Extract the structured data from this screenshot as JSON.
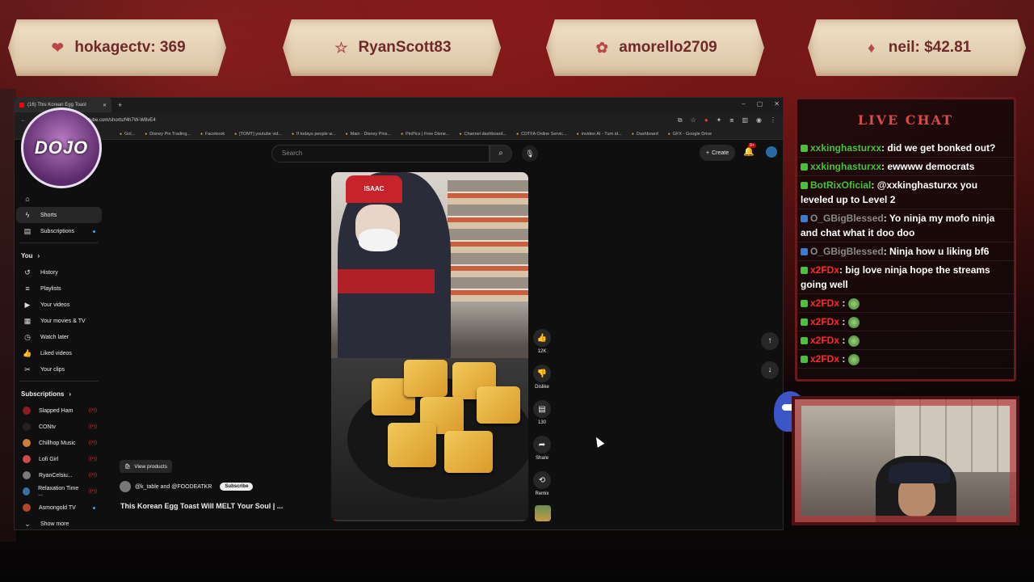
{
  "overlay": {
    "names": [
      {
        "text": "hokagectv: 369",
        "icon": "heart-badge-icon"
      },
      {
        "text": "RyanScott83",
        "icon": "star-icon"
      },
      {
        "text": "amorello2709",
        "icon": "gift-icon"
      },
      {
        "text": "neil: $42.81",
        "icon": "diamond-icon"
      }
    ],
    "logo_text": "DOJO"
  },
  "browser": {
    "tab_title": "(16) This Korean Egg Toast",
    "url": "youtube.com/shorts/f4h7W-W8vE4",
    "bookmarks": [
      "Gol...",
      "Disney Pin Trading...",
      "Facebook",
      "[TOMT] youtube vid...",
      "If todays people w...",
      "Main - Disney Pins...",
      "PinPics | Free Disne...",
      "Channel dashboard...",
      "CDTFA Online Servic...",
      "invideo AI - Turn id...",
      "Dashboard",
      "GFX - Google Drive"
    ]
  },
  "youtube": {
    "search_placeholder": "Search",
    "create_label": "Create",
    "notif_count": "9+",
    "nav": {
      "shorts": "Shorts",
      "subscriptions": "Subscriptions",
      "you": "You",
      "history": "History",
      "playlists": "Playlists",
      "your_videos": "Your videos",
      "movies": "Your movies & TV",
      "watch_later": "Watch later",
      "liked": "Liked videos",
      "clips": "Your clips",
      "subs_header": "Subscriptions",
      "show_more": "Show more"
    },
    "subscriptions": [
      {
        "name": "Slapped Ham",
        "color": "#8a1d1d",
        "status": "live"
      },
      {
        "name": "CONtv",
        "color": "#222222",
        "status": "live"
      },
      {
        "name": "Chillhop Music",
        "color": "#c9803a",
        "status": "live"
      },
      {
        "name": "Lofi Girl",
        "color": "#d04a4a",
        "status": "live"
      },
      {
        "name": "RyanCelsiu...",
        "color": "#7a7a7a",
        "status": "live"
      },
      {
        "name": "Relaxation Time ...",
        "color": "#3b6fa0",
        "status": "live"
      },
      {
        "name": "Asmongold TV",
        "color": "#b5452b",
        "status": "new"
      }
    ],
    "actions": {
      "likes": "12K",
      "dislike": "Dislike",
      "comments": "130",
      "share": "Share",
      "remix": "Remix"
    },
    "video": {
      "view_products": "View products",
      "channel": "@k_table and @FOODEATKR",
      "subscribe": "Subscribe",
      "title": "This Korean Egg Toast Will MELT Your Soul  | ...",
      "cap_text": "ISAAC",
      "progress": 0.02
    }
  },
  "chat": {
    "title": "LIVE CHAT",
    "messages": [
      {
        "user": "xxkinghasturxx",
        "cls": "u-green",
        "text": ": did we get bonked out?",
        "badge": "#49c23a"
      },
      {
        "user": "xxkinghasturxx",
        "cls": "u-green",
        "text": ": ewwww democrats",
        "badge": "#49c23a"
      },
      {
        "user": "BotRixOficial",
        "cls": "u-green",
        "text": ": @xxkinghasturxx you leveled up to Level 2",
        "badge": "#49c23a"
      },
      {
        "user": "O_GBigBlessed",
        "cls": "u-gray",
        "text": ": Yo ninja my mofo ninja and chat what it doo doo",
        "badge": "#3a7bd5"
      },
      {
        "user": "O_GBigBlessed",
        "cls": "u-gray",
        "text": ": Ninja how u liking bf6",
        "badge": "#3a7bd5"
      },
      {
        "user": "x2FDx",
        "cls": "u-red",
        "text": ": big love ninja hope the streams going well",
        "badge": "#49c23a"
      },
      {
        "user": "x2FDx",
        "cls": "u-red",
        "text": " : ",
        "badge": "#49c23a",
        "emote": true
      },
      {
        "user": "x2FDx",
        "cls": "u-red",
        "text": " : ",
        "badge": "#49c23a",
        "emote": true
      },
      {
        "user": "x2FDx",
        "cls": "u-red",
        "text": " : ",
        "badge": "#49c23a",
        "emote": true
      },
      {
        "user": "x2FDx",
        "cls": "u-red",
        "text": " : ",
        "badge": "#49c23a",
        "emote": true
      }
    ]
  }
}
